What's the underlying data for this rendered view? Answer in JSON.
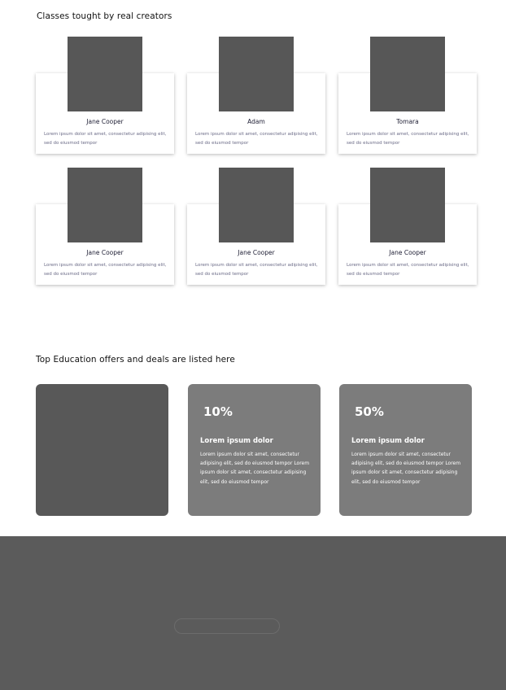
{
  "classes": {
    "title": "Classes tought by real creators",
    "cards": [
      {
        "name": "Jane Cooper",
        "description": "Lorem ipsum dolor sit amet, consectetur adipising elit, sed do eiusmod tempor"
      },
      {
        "name": "Adam",
        "description": "Lorem ipsum dolor sit amet, consectetur adipising elit, sed do eiusmod tempor"
      },
      {
        "name": "Tomara",
        "description": "Lorem ipsum dolor sit amet, consectetur adipising elit, sed do eiusmod tempor"
      },
      {
        "name": "Jane Cooper",
        "description": "Lorem ipsum dolor sit amet, consectetur adipising elit, sed do eiusmod tempor"
      },
      {
        "name": "Jane Cooper",
        "description": "Lorem ipsum dolor sit amet, consectetur adipising elit, sed do eiusmod tempor"
      },
      {
        "name": "Jane Cooper",
        "description": "Lorem ipsum dolor sit amet, consectetur adipising elit, sed do eiusmod tempor"
      }
    ]
  },
  "offers": {
    "title": "Top Education offers and deals are listed here",
    "deals": [
      {
        "percent": "10%",
        "heading": "Lorem ipsum dolor",
        "text": "Lorem ipsum dolor sit amet, consectetur adipising elit, sed do eiusmod tempor Lorem ipsum dolor sit amet, consectetur adipising elit, sed do eiusmod tempor"
      },
      {
        "percent": "50%",
        "heading": "Lorem ipsum dolor",
        "text": "Lorem ipsum dolor sit amet, consectetur adipising elit, sed do eiusmod tempor Lorem ipsum dolor sit amet, consectetur adipising elit, sed do eiusmod tempor"
      }
    ]
  },
  "footer": {
    "input_placeholder": ""
  },
  "colors": {
    "placeholder_gray": "#575757",
    "deal_card": "#7c7c7c",
    "footer": "#5b5b5b",
    "description_text": "#6a6a86"
  }
}
